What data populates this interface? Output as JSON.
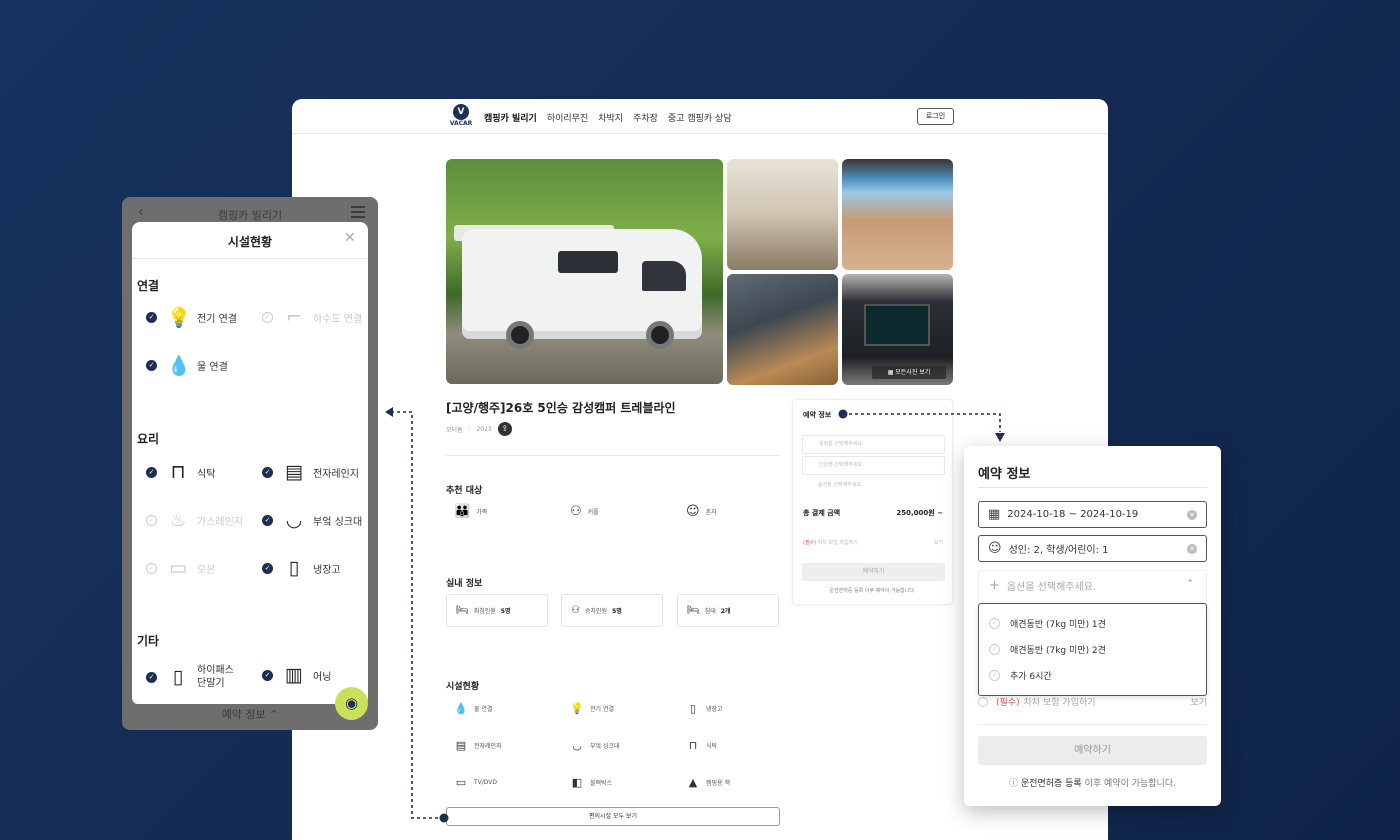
{
  "header": {
    "logo_text": "VACAR",
    "logo_mark": "V",
    "nav": [
      "캠핑카 빌리기",
      "하이리무진",
      "차박지",
      "주차장",
      "중고 캠핑카 상담"
    ],
    "login": "로그인"
  },
  "gallery": {
    "view_all": "모든사진 보기"
  },
  "listing": {
    "title": "[고양/행주]26호 5인승 감성캠퍼 트레블라인",
    "meta": [
      "모터홈",
      "2023"
    ],
    "share_icon": "share-icon"
  },
  "recommend": {
    "title": "추천 대상",
    "items": [
      {
        "icon": "group-icon",
        "label": "가족"
      },
      {
        "icon": "couple-icon",
        "label": "커플"
      },
      {
        "icon": "person-icon",
        "label": "혼자"
      }
    ]
  },
  "indoor": {
    "title": "실내 정보",
    "items": [
      {
        "icon": "bed-icon",
        "label": "취침인원",
        "value": "5명"
      },
      {
        "icon": "seat-icon",
        "label": "승차인원",
        "value": "5명"
      },
      {
        "icon": "bed-icon",
        "label": "침대",
        "value": "2개"
      }
    ]
  },
  "facilities": {
    "title": "시설현황",
    "items": [
      {
        "icon": "water-drop-icon",
        "label": "물 연결"
      },
      {
        "icon": "bulb-icon",
        "label": "전기 연결"
      },
      {
        "icon": "fridge-icon",
        "label": "냉장고"
      },
      {
        "icon": "microwave-icon",
        "label": "전자레인지"
      },
      {
        "icon": "sink-icon",
        "label": "부엌 싱크대"
      },
      {
        "icon": "table-icon",
        "label": "식탁"
      },
      {
        "icon": "tv-icon",
        "label": "TV/DVD"
      },
      {
        "icon": "dashcam-icon",
        "label": "블랙박스"
      },
      {
        "icon": "camp-icon",
        "label": "캠핑용 책"
      }
    ],
    "more": "편의시설 모두 보기"
  },
  "mini_booking": {
    "title": "예약 정보",
    "fields": [
      "일정을 선택해주세요.",
      "인원을 선택해주세요.",
      "옵션을 선택해주세요."
    ],
    "total_label": "총 결제 금액",
    "total_value": "250,000원 ~",
    "insurance_req": "(필수)",
    "insurance": "차차 보험 가입하기",
    "insurance_view": "보기",
    "button": "예약하기",
    "note_bold": "운전면허증 등록",
    "note": "이후 예약이 가능합니다."
  },
  "phone": {
    "top_title": "캠핑카 빌리기",
    "sheet_title": "시설현황",
    "categories": {
      "connect": "연결",
      "cook": "요리",
      "etc": "기타"
    },
    "items": [
      {
        "label": "전기 연결",
        "icon": "bulb-icon",
        "on": true
      },
      {
        "label": "하수도 연결",
        "icon": "faucet-icon",
        "on": false
      },
      {
        "label": "물 연결",
        "icon": "water-drop-icon",
        "on": true
      },
      {
        "label": "식탁",
        "icon": "table-icon",
        "on": true
      },
      {
        "label": "전자레인지",
        "icon": "microwave-icon",
        "on": true
      },
      {
        "label": "가스레인지",
        "icon": "gas-flame-icon",
        "on": false
      },
      {
        "label": "부엌 싱크대",
        "icon": "sink-icon",
        "on": true
      },
      {
        "label": "오븐",
        "icon": "oven-icon",
        "on": false
      },
      {
        "label": "냉장고",
        "icon": "fridge-icon",
        "on": true
      },
      {
        "label": "하이패스\n단말기",
        "icon": "hipass-icon",
        "on": true
      },
      {
        "label": "어닝",
        "icon": "awning-icon",
        "on": true
      }
    ],
    "bottom_label": "예약 정보"
  },
  "booking_card": {
    "title": "예약 정보",
    "date_range": "2024-10-18 ~ 2024-10-19",
    "guests": "성인: 2, 학생/어린이: 1",
    "option_placeholder": "옵션을 선택해주세요.",
    "options": [
      "애견동반 (7kg 미만) 1견",
      "애견동반 (7kg 미만) 2견",
      "추가 6시간"
    ],
    "insurance_req": "(필수)",
    "insurance": "차차 보험 가입하기",
    "insurance_view": "보기",
    "reserve": "예약하기",
    "note_bold": "운전면허증 등록",
    "note": "이후 예약이 가능합니다."
  },
  "colors": {
    "background": "#142a52",
    "accent_navy": "#1e2e52",
    "chat_lime": "#cbe05a",
    "required_red": "#e25757"
  }
}
